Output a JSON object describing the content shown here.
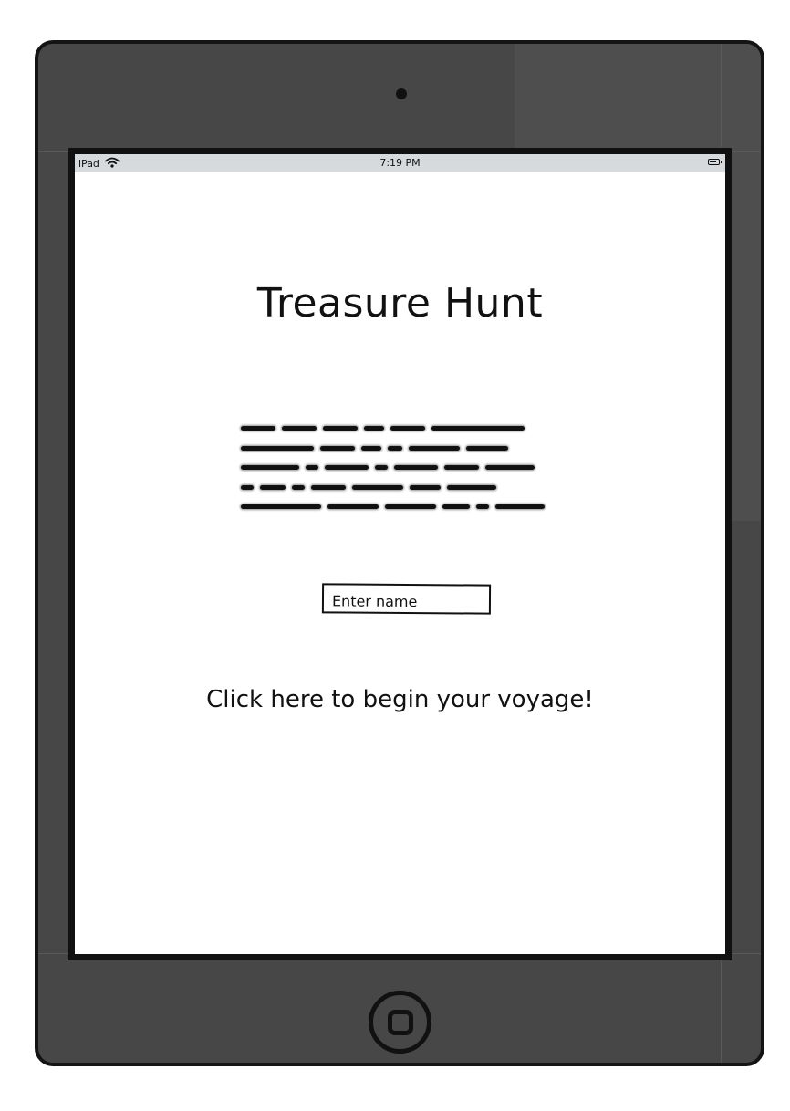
{
  "status_bar": {
    "device_label": "iPad",
    "wifi_icon": "wifi-icon",
    "time": "7:19 PM",
    "battery_icon": "battery-icon"
  },
  "main": {
    "title": "Treasure Hunt",
    "name_input": {
      "value": "",
      "placeholder": "Enter name"
    },
    "begin_link": "Click here to begin your voyage!"
  },
  "colors": {
    "device_body": "#474747",
    "device_outline": "#141414",
    "screen_background": "#ffffff",
    "status_bar_background": "#d6dadd",
    "text": "#111111"
  },
  "icons": {
    "camera": "camera-icon",
    "home_button": "home-button-icon"
  }
}
